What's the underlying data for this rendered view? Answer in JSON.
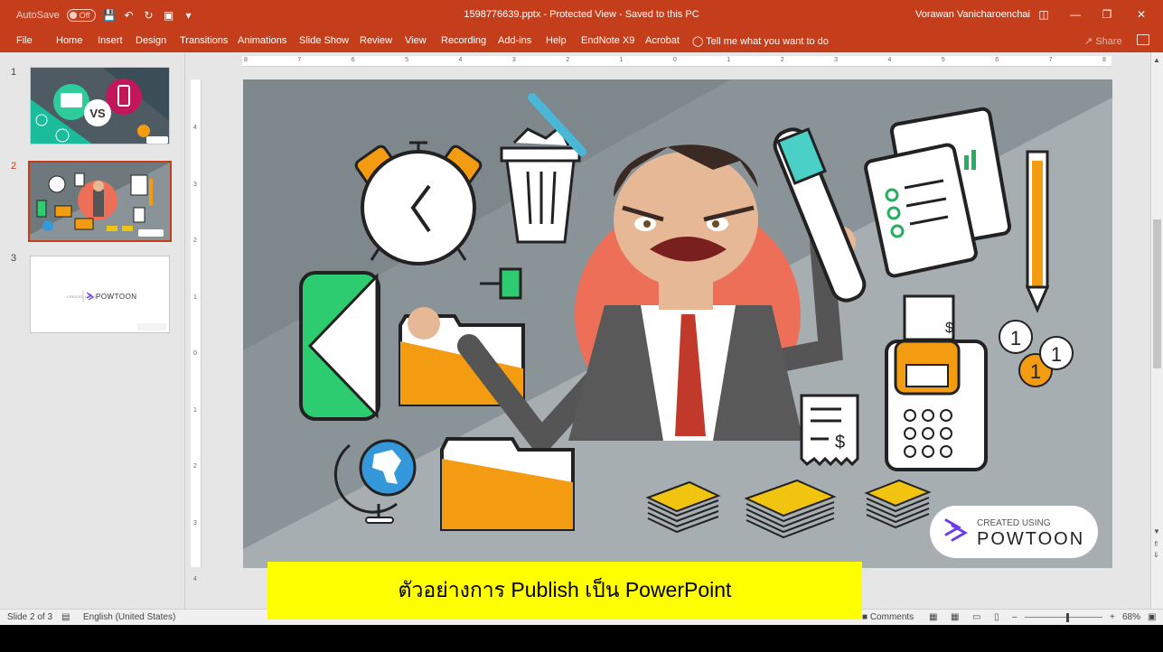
{
  "titlebar": {
    "autosave_label": "AutoSave",
    "autosave_state": "Off",
    "document_title": "1598776639.pptx  -  Protected View  -  Saved to this PC",
    "user_name": "Vorawan Vanicharoenchai"
  },
  "ribbon": {
    "tabs": [
      "File",
      "Home",
      "Insert",
      "Design",
      "Transitions",
      "Animations",
      "Slide Show",
      "Review",
      "View",
      "Recording",
      "Add-ins",
      "Help",
      "EndNote X9",
      "Acrobat"
    ],
    "tell_me": "Tell me what you want to do",
    "share": "Share"
  },
  "thumbnails": {
    "numbers": [
      "1",
      "2",
      "3"
    ],
    "selected": 2,
    "slide1_vs": "VS",
    "slide3_brand": "POWTOON",
    "slide3_created": "CREATED USING"
  },
  "ruler": {
    "horizontal": [
      "8",
      "7",
      "6",
      "5",
      "4",
      "3",
      "2",
      "1",
      "0",
      "1",
      "2",
      "3",
      "4",
      "5",
      "6",
      "7",
      "8"
    ],
    "vertical": [
      "4",
      "3",
      "2",
      "1",
      "0",
      "1",
      "2",
      "3",
      "4"
    ]
  },
  "slide": {
    "dollar1": "$",
    "dollar2": "$",
    "coin1": "1",
    "coin2": "1",
    "coin3": "1",
    "badge_created": "CREATED USING",
    "badge_brand": "POWTOON"
  },
  "statusbar": {
    "slide_info": "Slide 2 of 3",
    "language": "English (United States)",
    "comments": "Comments",
    "zoom": "68%"
  },
  "caption": {
    "text": "ตัวอย่างการ Publish เป็น PowerPoint"
  },
  "colors": {
    "accent": "#c43e1c",
    "caption_bg": "#ffff00",
    "slide_bg_dark": "#8a9397",
    "slide_bg_light": "#a6aeb1",
    "orange": "#f39c12",
    "green": "#2ecc71",
    "coral": "#ee6f57"
  }
}
